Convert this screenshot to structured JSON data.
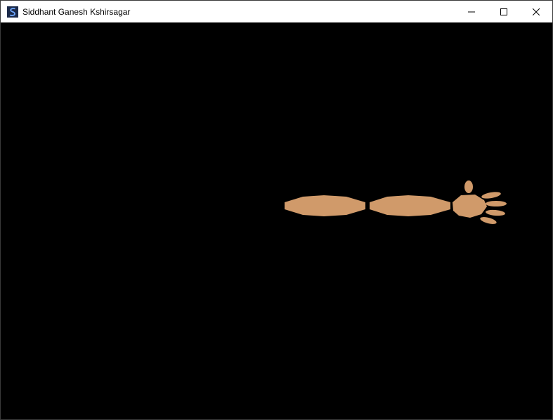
{
  "window": {
    "title": "Siddhant Ganesh Kshirsagar",
    "app_icon": "opengl-app-icon",
    "controls": {
      "minimize_icon": "minimize-icon",
      "maximize_icon": "maximize-icon",
      "close_icon": "close-icon"
    }
  },
  "scene": {
    "background_color": "#000000",
    "skin_color": "#D09A6A",
    "parts": [
      "upper-arm",
      "forearm",
      "palm",
      "thumb",
      "finger-1",
      "finger-2",
      "finger-3",
      "finger-4"
    ]
  }
}
